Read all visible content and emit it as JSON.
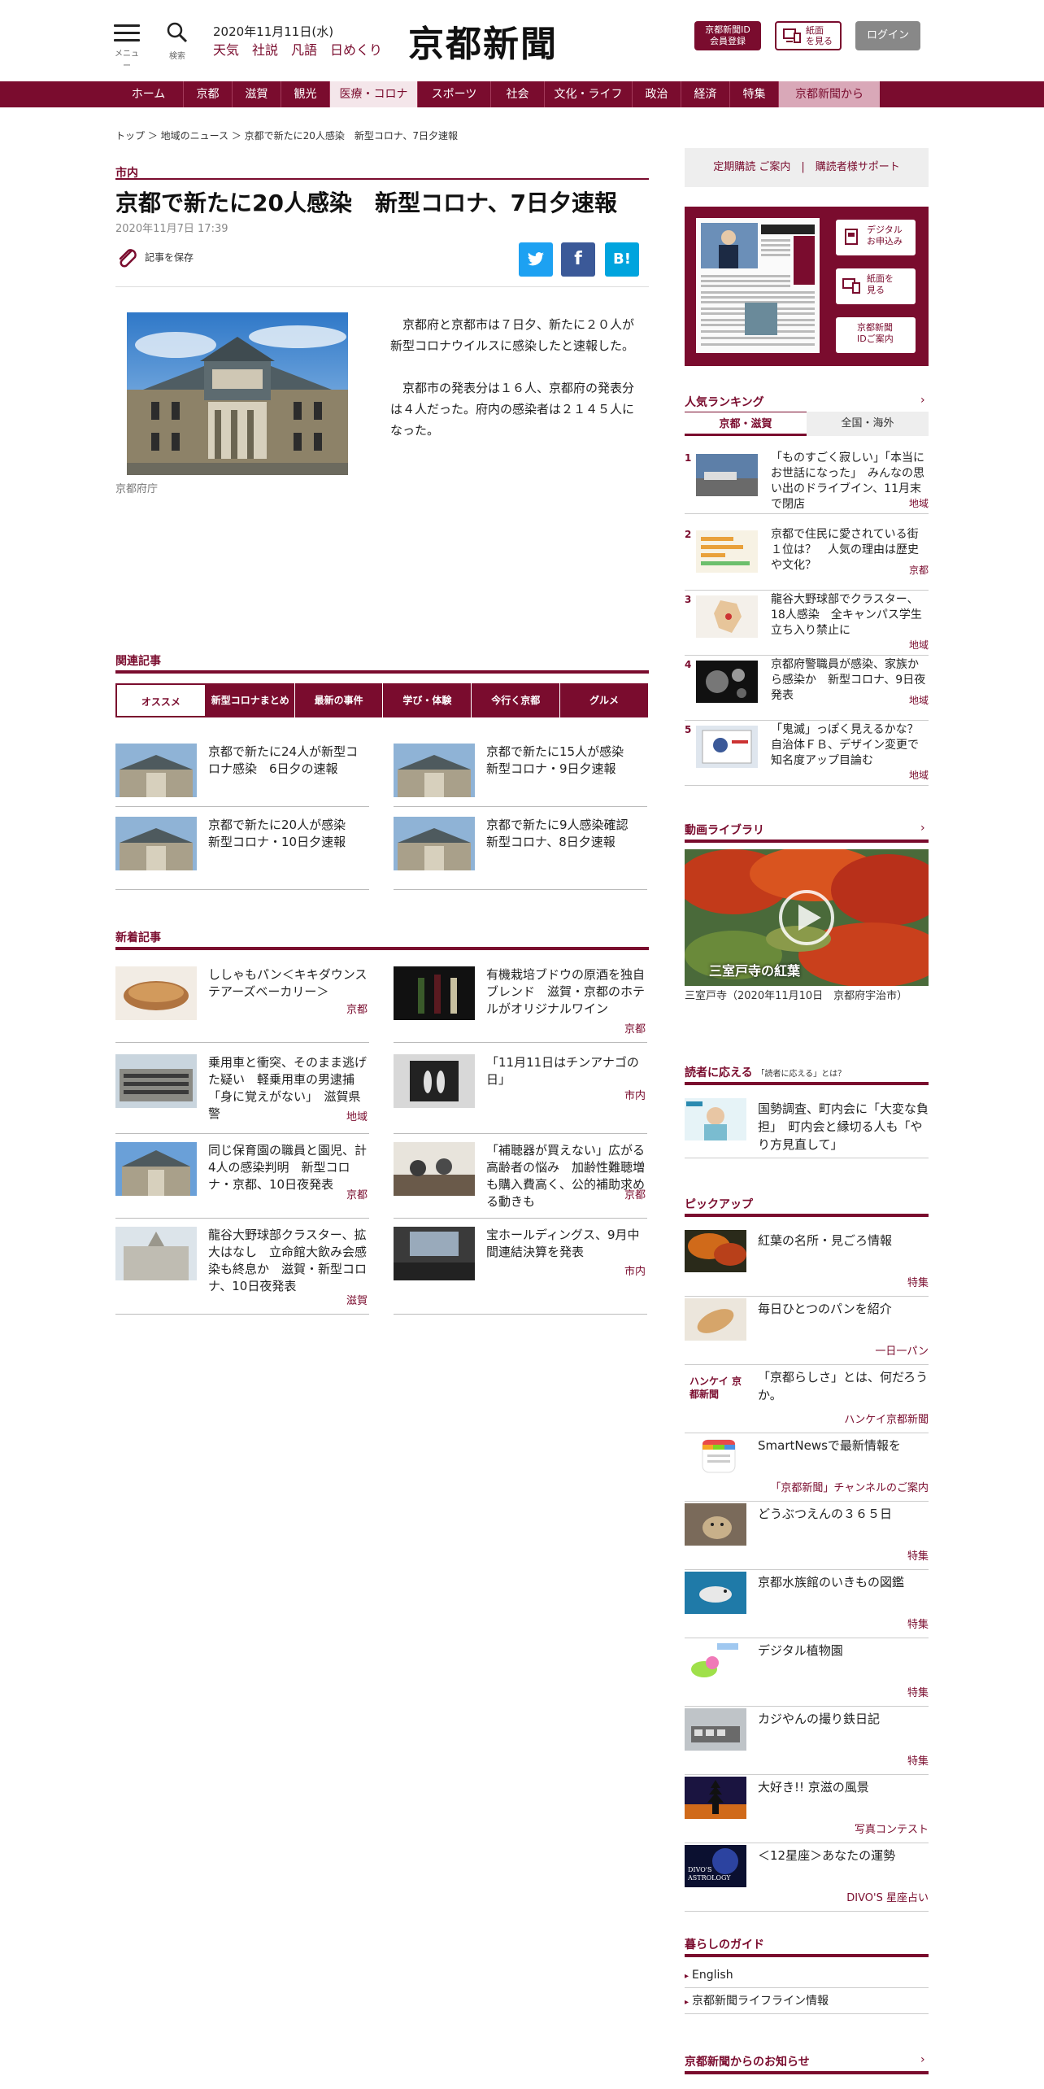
{
  "header": {
    "menu_caption": "メニュー",
    "search_caption": "検索",
    "date": "2020年11月11日(水)",
    "links": [
      "天気",
      "社説",
      "凡語",
      "日めくり"
    ],
    "logo": "京都新聞",
    "id_btn_1": "京都新聞ID",
    "id_btn_2": "会員登録",
    "shimen_1": "紙面",
    "shimen_2": "を見る",
    "login": "ログイン"
  },
  "nav": [
    "ホーム",
    "京都",
    "滋賀",
    "観光",
    "医療・コロナ",
    "スポーツ",
    "社会",
    "文化・ライフ",
    "政治",
    "経済",
    "特集",
    "京都新聞から"
  ],
  "article": {
    "breadcrumb": "トップ ＞ 地域のニュース ＞ 京都で新たに20人感染　新型コロナ、7日夕速報",
    "category": "市内",
    "title": "京都で新たに20人感染　新型コロナ、7日夕速報",
    "date": "2020年11月7日 17:39",
    "save": "記事を保存",
    "photo_caption": "京都府庁",
    "paragraphs": [
      "京都府と京都市は７日夕、新たに２０人が新型コロナウイルスに感染したと速報した。",
      "京都市の発表分は１６人、京都府の発表分は４人だった。府内の感染者は２１４５人になった。"
    ]
  },
  "related": {
    "heading": "関連記事",
    "tabs": [
      "オススメ",
      "新型コロナまとめ",
      "最新の事件",
      "学び・体験",
      "今行く京都",
      "グルメ"
    ],
    "items": [
      "京都で新たに24人が新型コロナ感染　6日夕の速報",
      "京都で新たに15人が感染　新型コロナ・9日夕速報",
      "京都で新たに20人が感染　新型コロナ・10日夕速報",
      "京都で新たに9人感染確認　新型コロナ、8日夕速報"
    ]
  },
  "newest": {
    "heading": "新着記事",
    "items": [
      {
        "title": "ししゃもパン＜キキダウンステアーズベーカリー＞",
        "tag": "京都"
      },
      {
        "title": "有機栽培ブドウの原酒を独自ブレンド　滋賀・京都のホテルがオリジナルワイン",
        "tag": "京都"
      },
      {
        "title": "乗用車と衝突、そのまま逃げた疑い　軽乗用車の男逮捕「身に覚えがない」　滋賀県警",
        "tag": "地域"
      },
      {
        "title": "「11月11日はチンアナゴの日」",
        "tag": "市内"
      },
      {
        "title": "同じ保育園の職員と園児、計4人の感染判明　新型コロナ・京都、10日夜発表",
        "tag": "京都"
      },
      {
        "title": "「補聴器が買えない」広がる高齢者の悩み　加齢性難聴増も購入費高く、公的補助求める動きも",
        "tag": "京都"
      },
      {
        "title": "龍谷大野球部クラスター、拡大はなし　立命館大飲み会感染も終息か　滋賀・新型コロナ、10日夜発表",
        "tag": "滋賀"
      },
      {
        "title": "宝ホールディングス、9月中間連結決算を発表",
        "tag": "市内"
      }
    ]
  },
  "sidebar": {
    "subscribe": "定期購読 ご案内　|　購読者様サポート",
    "digital": [
      [
        "デジタル",
        "お申込み"
      ],
      [
        "紙面を",
        "見る"
      ],
      [
        "京都新聞",
        "IDご案内"
      ]
    ],
    "ranking_heading": "人気ランキング",
    "ranking_tabs": [
      "京都・滋賀",
      "全国・海外"
    ],
    "ranking": [
      {
        "n": "1",
        "title": "「ものすごく寂しい」「本当にお世話になった」　みんなの思い出のドライブイン、11月末で閉店",
        "tag": "地域"
      },
      {
        "n": "2",
        "title": "京都で住民に愛されている街１位は？　人気の理由は歴史や文化？",
        "tag": "京都"
      },
      {
        "n": "3",
        "title": "龍谷大野球部でクラスター、18人感染　全キャンパス学生立ち入り禁止に",
        "tag": "地域"
      },
      {
        "n": "4",
        "title": "京都府警職員が感染、家族から感染か　新型コロナ、9日夜発表",
        "tag": "地域"
      },
      {
        "n": "5",
        "title": "「鬼滅」っぽく見えるかな？　自治体ＦＢ、デザイン変更で知名度アップ目論む",
        "tag": "地域"
      }
    ],
    "video_heading": "動画ライブラリ",
    "video_title": "三室戸寺の紅葉",
    "video_caption": "三室戸寺（2020年11月10日　京都府宇治市）",
    "reader_heading": "読者に応える",
    "reader_sub": "「読者に応える」とは？",
    "reader_item": "国勢調査、町内会に「大変な負担」　町内会と縁切る人も「やり方見直して」",
    "pickup_heading": "ピックアップ",
    "pickup": [
      {
        "title": "紅葉の名所・見ごろ情報",
        "tag": "特集"
      },
      {
        "title": "毎日ひとつのパンを紹介",
        "tag": "一日一パン"
      },
      {
        "title": "「京都らしさ」とは、何だろうか。",
        "tag": "ハンケイ京都新聞"
      },
      {
        "title": "SmartNewsで最新情報を",
        "tag": "「京都新聞」チャンネルのご案内"
      },
      {
        "title": "どうぶつえんの３６５日",
        "tag": "特集"
      },
      {
        "title": "京都水族館のいきもの図鑑",
        "tag": "特集"
      },
      {
        "title": "デジタル植物園",
        "tag": "特集"
      },
      {
        "title": "カジやんの撮り鉄日記",
        "tag": "特集"
      },
      {
        "title": "大好き!! 京滋の風景",
        "tag": "写真コンテスト"
      },
      {
        "title": "＜12星座＞あなたの運勢",
        "tag": "DIVO'S 星座占い"
      }
    ],
    "hankei_logo": "ハンケイ 京都新聞",
    "divo_logo": "DIVO'S ASTROLOGY",
    "guide_heading": "暮らしのガイド",
    "guide": [
      "English",
      "京都新聞ライフライン情報"
    ],
    "notice_heading": "京都新聞からのお知らせ"
  },
  "colors": {
    "brand": "#7a0c2e"
  }
}
